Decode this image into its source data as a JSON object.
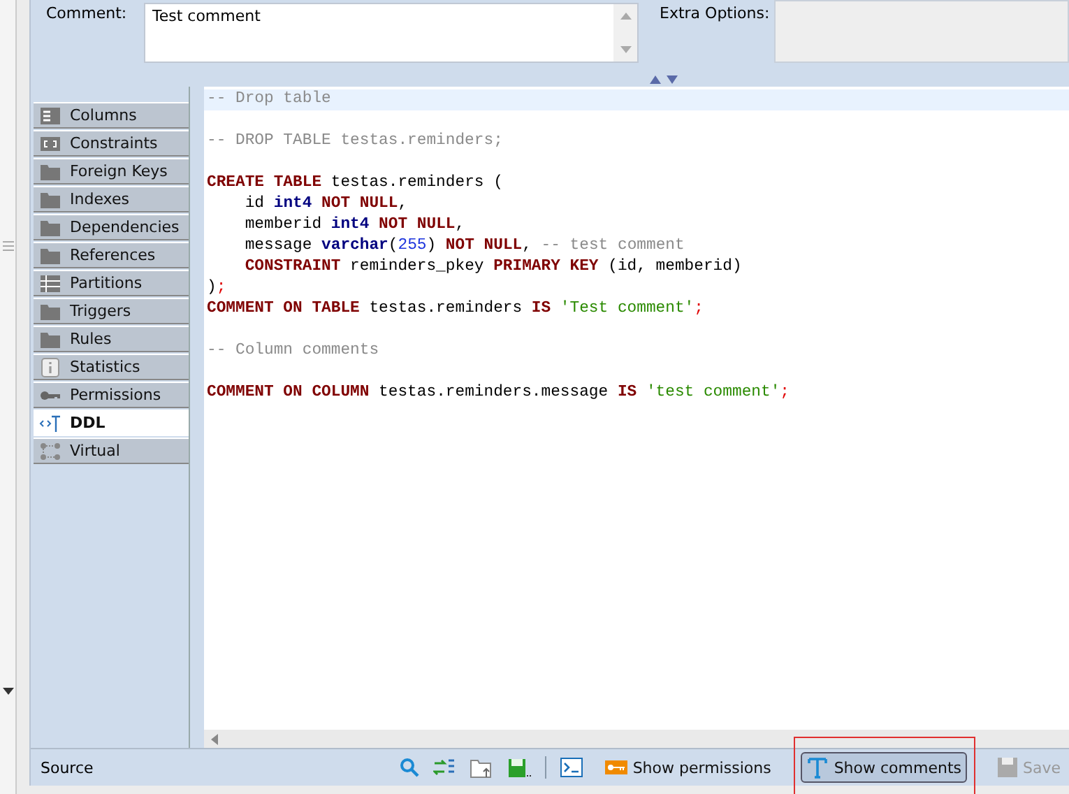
{
  "comment": {
    "label": "Comment:",
    "value": "Test comment"
  },
  "extra_options": {
    "label": "Extra Options:"
  },
  "tabs": [
    {
      "label": "Columns",
      "kind": "list",
      "selected": false
    },
    {
      "label": "Constraints",
      "kind": "constraint",
      "selected": false
    },
    {
      "label": "Foreign Keys",
      "kind": "folder",
      "selected": false
    },
    {
      "label": "Indexes",
      "kind": "folder",
      "selected": false
    },
    {
      "label": "Dependencies",
      "kind": "folder",
      "selected": false
    },
    {
      "label": "References",
      "kind": "folder",
      "selected": false
    },
    {
      "label": "Partitions",
      "kind": "partition",
      "selected": false
    },
    {
      "label": "Triggers",
      "kind": "folder",
      "selected": false
    },
    {
      "label": "Rules",
      "kind": "folder",
      "selected": false
    },
    {
      "label": "Statistics",
      "kind": "info",
      "selected": false
    },
    {
      "label": "Permissions",
      "kind": "key",
      "selected": false
    },
    {
      "label": "DDL",
      "kind": "ddl",
      "selected": true
    },
    {
      "label": "Virtual",
      "kind": "virtual",
      "selected": false
    }
  ],
  "code_lines": [
    {
      "kind": "code",
      "highlighted": true,
      "tokens": [
        {
          "kind": "comment",
          "text": "-- Drop table"
        }
      ]
    },
    {
      "kind": "blank"
    },
    {
      "kind": "code",
      "highlighted": false,
      "tokens": [
        {
          "kind": "comment",
          "text": "-- DROP TABLE testas.reminders;"
        }
      ]
    },
    {
      "kind": "blank"
    },
    {
      "kind": "code",
      "highlighted": false,
      "tokens": [
        {
          "kind": "keyword",
          "text": "CREATE TABLE"
        },
        {
          "kind": "plain",
          "text": " testas.reminders ("
        }
      ]
    },
    {
      "kind": "code",
      "highlighted": false,
      "tokens": [
        {
          "kind": "plain",
          "text": "    id "
        },
        {
          "kind": "type",
          "text": "int4"
        },
        {
          "kind": "keyword",
          "text": " NOT NULL"
        },
        {
          "kind": "plain",
          "text": ","
        }
      ]
    },
    {
      "kind": "code",
      "highlighted": false,
      "tokens": [
        {
          "kind": "plain",
          "text": "    memberid "
        },
        {
          "kind": "type",
          "text": "int4"
        },
        {
          "kind": "keyword",
          "text": " NOT NULL"
        },
        {
          "kind": "plain",
          "text": ","
        }
      ]
    },
    {
      "kind": "code",
      "highlighted": false,
      "tokens": [
        {
          "kind": "plain",
          "text": "    message "
        },
        {
          "kind": "type",
          "text": "varchar"
        },
        {
          "kind": "plain",
          "text": "("
        },
        {
          "kind": "number",
          "text": "255"
        },
        {
          "kind": "plain",
          "text": ")"
        },
        {
          "kind": "keyword",
          "text": " NOT NULL"
        },
        {
          "kind": "plain",
          "text": ", "
        },
        {
          "kind": "comment",
          "text": "-- test comment"
        }
      ]
    },
    {
      "kind": "code",
      "highlighted": false,
      "tokens": [
        {
          "kind": "keyword",
          "text": "    CONSTRAINT"
        },
        {
          "kind": "plain",
          "text": " reminders_pkey "
        },
        {
          "kind": "keyword",
          "text": "PRIMARY KEY"
        },
        {
          "kind": "plain",
          "text": " (id, memberid)"
        }
      ]
    },
    {
      "kind": "code",
      "highlighted": false,
      "tokens": [
        {
          "kind": "plain",
          "text": ")"
        },
        {
          "kind": "punct",
          "text": ";"
        }
      ]
    },
    {
      "kind": "code",
      "highlighted": false,
      "tokens": [
        {
          "kind": "keyword",
          "text": "COMMENT ON TABLE"
        },
        {
          "kind": "plain",
          "text": " testas.reminders "
        },
        {
          "kind": "keyword",
          "text": "IS"
        },
        {
          "kind": "string",
          "text": " 'Test comment'"
        },
        {
          "kind": "punct",
          "text": ";"
        }
      ]
    },
    {
      "kind": "blank"
    },
    {
      "kind": "code",
      "highlighted": false,
      "tokens": [
        {
          "kind": "comment",
          "text": "-- Column comments"
        }
      ]
    },
    {
      "kind": "blank"
    },
    {
      "kind": "code",
      "highlighted": false,
      "tokens": [
        {
          "kind": "keyword",
          "text": "COMMENT ON COLUMN"
        },
        {
          "kind": "plain",
          "text": " testas.reminders.message "
        },
        {
          "kind": "keyword",
          "text": "IS"
        },
        {
          "kind": "string",
          "text": " 'test comment'"
        },
        {
          "kind": "punct",
          "text": ";"
        }
      ]
    }
  ],
  "status_bar": {
    "label": "Source",
    "tools": [
      {
        "kind": "search"
      },
      {
        "kind": "sync"
      },
      {
        "kind": "folder"
      },
      {
        "kind": "save"
      },
      {
        "kind": "separator"
      },
      {
        "kind": "terminal"
      }
    ],
    "buttons": [
      {
        "label": "Show permissions",
        "kind": "key",
        "selected": false,
        "disabled": false,
        "highlighted": false
      },
      {
        "label": "Show comments",
        "kind": "text",
        "selected": true,
        "disabled": false,
        "highlighted": true
      },
      {
        "label": "Save",
        "kind": "disk",
        "selected": false,
        "disabled": true,
        "highlighted": false
      }
    ]
  }
}
